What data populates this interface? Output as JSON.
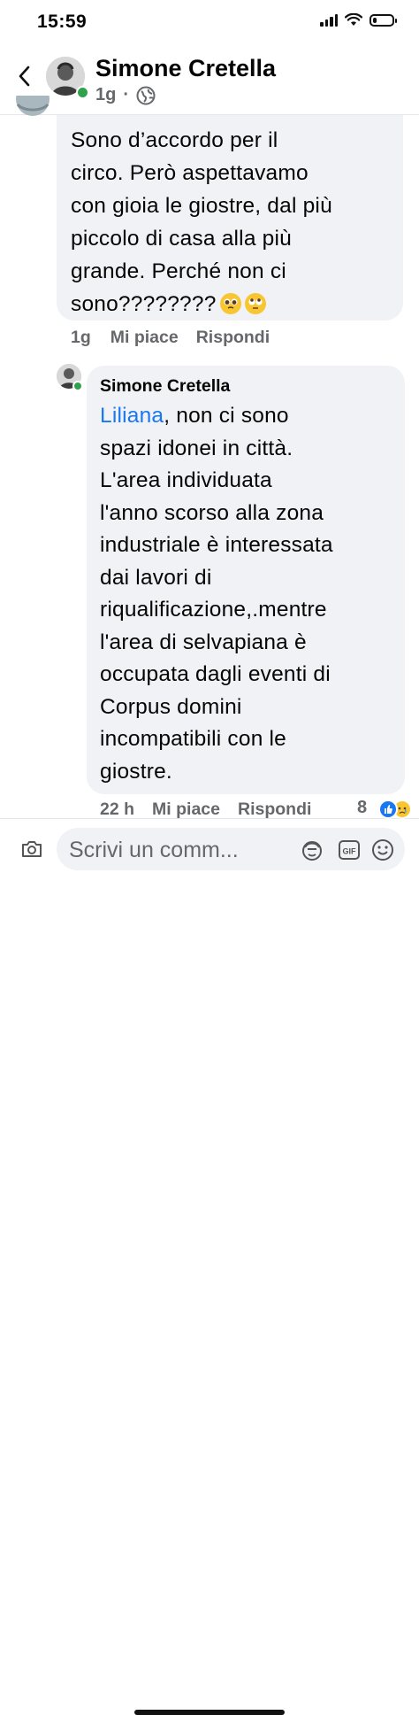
{
  "status_bar": {
    "time": "15:59",
    "battery_level": 0.2
  },
  "header": {
    "author_name": "Simone Cretella",
    "meta_time": "1g",
    "meta_separator": "·",
    "privacy_icon": "globe-icon"
  },
  "comment": {
    "lines": [
      "Sono d’accordo per il",
      "circo. Però aspettavamo",
      "con gioia le giostre, dal più",
      "piccolo di casa alla più",
      "grande. Perché non ci",
      "sono????????"
    ],
    "emojis": [
      "pleading-face-emoji",
      "rolling-eyes-emoji"
    ],
    "actions": {
      "time": "1g",
      "like": "Mi piace",
      "reply": "Rispondi"
    }
  },
  "reply": {
    "author": "Simone Cretella",
    "mention": "Liliana",
    "first_line_rest": ", non ci sono",
    "lines": [
      "spazi idonei in città.",
      "L'area individuata",
      "l'anno scorso alla zona",
      "industriale è interessata",
      "dai lavori di",
      "riqualificazione,.mentre",
      "l'area di selvapiana è",
      "occupata dagli eventi di",
      "Corpus domini",
      "incompatibili con le",
      "giostre."
    ],
    "actions": {
      "time": "22 h",
      "like": "Mi piace",
      "reply": "Rispondi"
    },
    "reaction_count": "8",
    "reactions": [
      "like-icon",
      "sad-icon"
    ]
  },
  "composer": {
    "placeholder": "Scrivi un comm...",
    "icons": [
      "camera-icon",
      "avatar-sticker-icon",
      "gif-icon",
      "emoji-icon"
    ]
  },
  "colors": {
    "accent": "#1877f2",
    "bubble": "#f0f2f5",
    "muted": "#65676b",
    "online": "#31a24c"
  }
}
